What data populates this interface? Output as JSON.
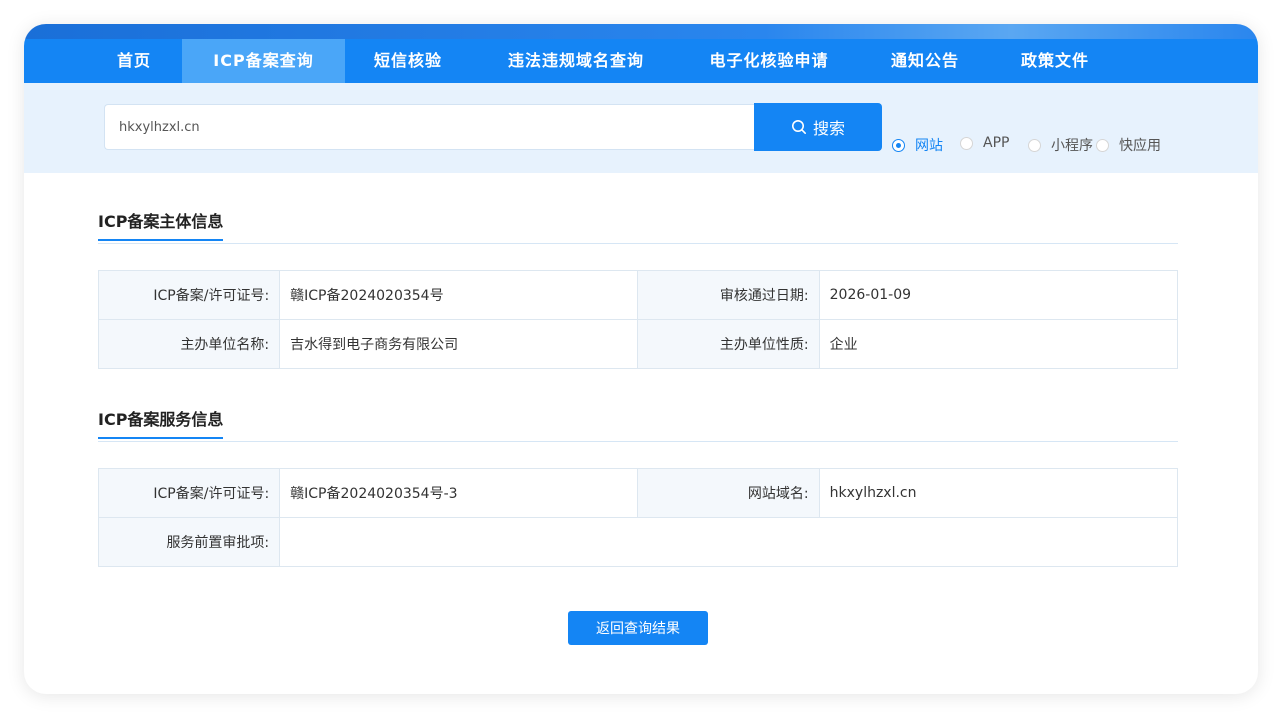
{
  "nav": {
    "items": [
      {
        "label": "首页"
      },
      {
        "label": "ICP备案查询"
      },
      {
        "label": "短信核验"
      },
      {
        "label": "违法违规域名查询"
      },
      {
        "label": "电子化核验申请"
      },
      {
        "label": "通知公告"
      },
      {
        "label": "政策文件"
      }
    ],
    "active_index": 1
  },
  "search": {
    "value": "hkxylhzxl.cn",
    "button_label": "搜索",
    "types": [
      {
        "label": "网站",
        "checked": true
      },
      {
        "label": "APP",
        "checked": false
      },
      {
        "label": "小程序",
        "checked": false
      },
      {
        "label": "快应用",
        "checked": false
      }
    ]
  },
  "subject": {
    "title": "ICP备案主体信息",
    "rows": [
      {
        "l1": "ICP备案/许可证号:",
        "v1": "赣ICP备2024020354号",
        "l2": "审核通过日期:",
        "v2": "2026-01-09"
      },
      {
        "l1": "主办单位名称:",
        "v1": "吉水得到电子商务有限公司",
        "l2": "主办单位性质:",
        "v2": "企业"
      }
    ]
  },
  "service": {
    "title": "ICP备案服务信息",
    "row1": {
      "l1": "ICP备案/许可证号:",
      "v1": "赣ICP备2024020354号-3",
      "l2": "网站域名:",
      "v2": "hkxylhzxl.cn"
    },
    "row2": {
      "l1": "服务前置审批项:",
      "v1": ""
    }
  },
  "return_button": "返回查询结果",
  "colors": {
    "primary": "#1485f4",
    "nav_active": "#4aa6f8",
    "band": "#e7f2fd"
  },
  "icons": {
    "search": "search-icon"
  }
}
